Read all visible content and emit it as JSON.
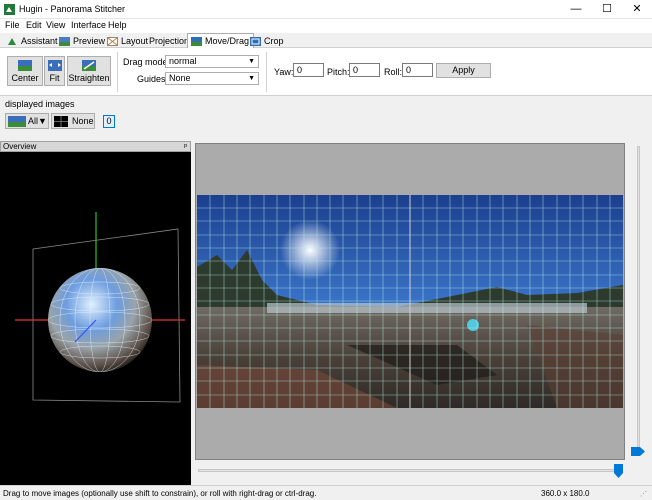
{
  "window": {
    "title": "Hugin - Panorama Stitcher",
    "minimize_glyph": "—",
    "maximize_glyph": "☐",
    "close_glyph": "✕"
  },
  "menu": [
    "File",
    "Edit",
    "View",
    "Interface",
    "Help"
  ],
  "tabs": [
    {
      "label": "Assistant",
      "icon": "assistant-icon"
    },
    {
      "label": "Preview",
      "icon": "preview-icon"
    },
    {
      "label": "Layout",
      "icon": "layout-icon"
    },
    {
      "label": "Projection",
      "icon": "projection-icon"
    },
    {
      "label": "Move/Drag",
      "icon": "move-drag-icon",
      "active": true
    },
    {
      "label": "Crop",
      "icon": "crop-icon"
    }
  ],
  "toolbar": {
    "center_label": "Center",
    "fit_label": "Fit",
    "straighten_label": "Straighten",
    "drag_mode_label": "Drag mode:",
    "drag_mode_value": "normal",
    "guides_label": "Guides:",
    "guides_value": "None",
    "yaw_label": "Yaw:",
    "yaw_value": "0",
    "pitch_label": "Pitch:",
    "pitch_value": "0",
    "roll_label": "Roll:",
    "roll_value": "0",
    "apply_label": "Apply"
  },
  "displayed_images": {
    "heading": "displayed images",
    "all_label": "All▼",
    "none_label": "None",
    "image_index": "0"
  },
  "overview": {
    "title": "Overview",
    "pin_glyph": "ᵖ"
  },
  "status": {
    "message": "Drag to move images (optionally use shift to constrain), or roll with right-drag or ctrl-drag.",
    "fov": "360.0 x 180.0"
  },
  "colors": {
    "accent": "#0078d7",
    "grid": "#b4f0e6",
    "axis_x": "#e03030",
    "axis_y": "#30c030",
    "axis_z": "#3050ff"
  }
}
